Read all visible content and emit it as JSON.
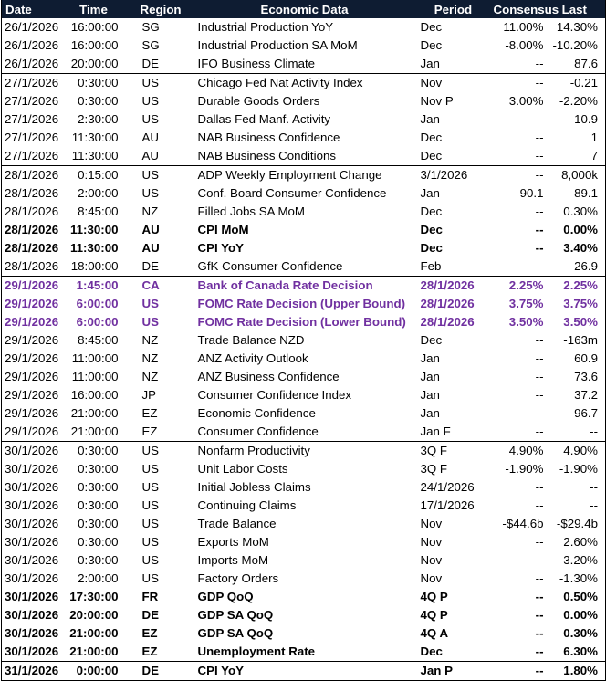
{
  "headers": {
    "date": "Date",
    "time": "Time",
    "region": "Region",
    "event": "Economic Data",
    "period": "Period",
    "consensus": "Consensus",
    "last": "Last"
  },
  "rows": [
    {
      "date": "26/1/2026",
      "time": "16:00:00",
      "region": "SG",
      "event": "Industrial Production YoY",
      "period": "Dec",
      "consensus": "11.00%",
      "last": "14.30%",
      "style": "",
      "group_start": false
    },
    {
      "date": "26/1/2026",
      "time": "16:00:00",
      "region": "SG",
      "event": "Industrial Production SA MoM",
      "period": "Dec",
      "consensus": "-8.00%",
      "last": "-10.20%",
      "style": "",
      "group_start": false
    },
    {
      "date": "26/1/2026",
      "time": "20:00:00",
      "region": "DE",
      "event": "IFO Business Climate",
      "period": "Jan",
      "consensus": "--",
      "last": "87.6",
      "style": "",
      "group_start": false
    },
    {
      "date": "27/1/2026",
      "time": "0:30:00",
      "region": "US",
      "event": "Chicago Fed Nat Activity Index",
      "period": "Nov",
      "consensus": "--",
      "last": "-0.21",
      "style": "",
      "group_start": true
    },
    {
      "date": "27/1/2026",
      "time": "0:30:00",
      "region": "US",
      "event": "Durable Goods Orders",
      "period": "Nov P",
      "consensus": "3.00%",
      "last": "-2.20%",
      "style": "",
      "group_start": false
    },
    {
      "date": "27/1/2026",
      "time": "2:30:00",
      "region": "US",
      "event": "Dallas Fed Manf. Activity",
      "period": "Jan",
      "consensus": "--",
      "last": "-10.9",
      "style": "",
      "group_start": false
    },
    {
      "date": "27/1/2026",
      "time": "11:30:00",
      "region": "AU",
      "event": "NAB Business Confidence",
      "period": "Dec",
      "consensus": "--",
      "last": "1",
      "style": "",
      "group_start": false
    },
    {
      "date": "27/1/2026",
      "time": "11:30:00",
      "region": "AU",
      "event": "NAB Business Conditions",
      "period": "Dec",
      "consensus": "--",
      "last": "7",
      "style": "",
      "group_start": false
    },
    {
      "date": "28/1/2026",
      "time": "0:15:00",
      "region": "US",
      "event": "ADP Weekly Employment Change",
      "period": "3/1/2026",
      "consensus": "--",
      "last": "8,000k",
      "style": "",
      "group_start": true
    },
    {
      "date": "28/1/2026",
      "time": "2:00:00",
      "region": "US",
      "event": "Conf. Board Consumer Confidence",
      "period": "Jan",
      "consensus": "90.1",
      "last": "89.1",
      "style": "",
      "group_start": false
    },
    {
      "date": "28/1/2026",
      "time": "8:45:00",
      "region": "NZ",
      "event": "Filled Jobs SA MoM",
      "period": "Dec",
      "consensus": "--",
      "last": "0.30%",
      "style": "",
      "group_start": false
    },
    {
      "date": "28/1/2026",
      "time": "11:30:00",
      "region": "AU",
      "event": "CPI MoM",
      "period": "Dec",
      "consensus": "--",
      "last": "0.00%",
      "style": "bold",
      "group_start": false
    },
    {
      "date": "28/1/2026",
      "time": "11:30:00",
      "region": "AU",
      "event": "CPI YoY",
      "period": "Dec",
      "consensus": "--",
      "last": "3.40%",
      "style": "bold",
      "group_start": false
    },
    {
      "date": "28/1/2026",
      "time": "18:00:00",
      "region": "DE",
      "event": "GfK Consumer Confidence",
      "period": "Feb",
      "consensus": "--",
      "last": "-26.9",
      "style": "",
      "group_start": false
    },
    {
      "date": "29/1/2026",
      "time": "1:45:00",
      "region": "CA",
      "event": "Bank of Canada Rate Decision",
      "period": "28/1/2026",
      "consensus": "2.25%",
      "last": "2.25%",
      "style": "purple",
      "group_start": true
    },
    {
      "date": "29/1/2026",
      "time": "6:00:00",
      "region": "US",
      "event": "FOMC Rate Decision (Upper Bound)",
      "period": "28/1/2026",
      "consensus": "3.75%",
      "last": "3.75%",
      "style": "purple",
      "group_start": false
    },
    {
      "date": "29/1/2026",
      "time": "6:00:00",
      "region": "US",
      "event": "FOMC Rate Decision (Lower Bound)",
      "period": "28/1/2026",
      "consensus": "3.50%",
      "last": "3.50%",
      "style": "purple",
      "group_start": false
    },
    {
      "date": "29/1/2026",
      "time": "8:45:00",
      "region": "NZ",
      "event": "Trade Balance NZD",
      "period": "Dec",
      "consensus": "--",
      "last": "-163m",
      "style": "",
      "group_start": false
    },
    {
      "date": "29/1/2026",
      "time": "11:00:00",
      "region": "NZ",
      "event": "ANZ Activity Outlook",
      "period": "Jan",
      "consensus": "--",
      "last": "60.9",
      "style": "",
      "group_start": false
    },
    {
      "date": "29/1/2026",
      "time": "11:00:00",
      "region": "NZ",
      "event": "ANZ Business Confidence",
      "period": "Jan",
      "consensus": "--",
      "last": "73.6",
      "style": "",
      "group_start": false
    },
    {
      "date": "29/1/2026",
      "time": "16:00:00",
      "region": "JP",
      "event": "Consumer Confidence Index",
      "period": "Jan",
      "consensus": "--",
      "last": "37.2",
      "style": "",
      "group_start": false
    },
    {
      "date": "29/1/2026",
      "time": "21:00:00",
      "region": "EZ",
      "event": "Economic Confidence",
      "period": "Jan",
      "consensus": "--",
      "last": "96.7",
      "style": "",
      "group_start": false
    },
    {
      "date": "29/1/2026",
      "time": "21:00:00",
      "region": "EZ",
      "event": "Consumer Confidence",
      "period": "Jan F",
      "consensus": "--",
      "last": "--",
      "style": "",
      "group_start": false
    },
    {
      "date": "30/1/2026",
      "time": "0:30:00",
      "region": "US",
      "event": "Nonfarm Productivity",
      "period": "3Q F",
      "consensus": "4.90%",
      "last": "4.90%",
      "style": "",
      "group_start": true
    },
    {
      "date": "30/1/2026",
      "time": "0:30:00",
      "region": "US",
      "event": "Unit Labor Costs",
      "period": "3Q F",
      "consensus": "-1.90%",
      "last": "-1.90%",
      "style": "",
      "group_start": false
    },
    {
      "date": "30/1/2026",
      "time": "0:30:00",
      "region": "US",
      "event": "Initial Jobless Claims",
      "period": "24/1/2026",
      "consensus": "--",
      "last": "--",
      "style": "",
      "group_start": false
    },
    {
      "date": "30/1/2026",
      "time": "0:30:00",
      "region": "US",
      "event": "Continuing Claims",
      "period": "17/1/2026",
      "consensus": "--",
      "last": "--",
      "style": "",
      "group_start": false
    },
    {
      "date": "30/1/2026",
      "time": "0:30:00",
      "region": "US",
      "event": "Trade Balance",
      "period": "Nov",
      "consensus": "-$44.6b",
      "last": "-$29.4b",
      "style": "",
      "group_start": false
    },
    {
      "date": "30/1/2026",
      "time": "0:30:00",
      "region": "US",
      "event": "Exports MoM",
      "period": "Nov",
      "consensus": "--",
      "last": "2.60%",
      "style": "",
      "group_start": false
    },
    {
      "date": "30/1/2026",
      "time": "0:30:00",
      "region": "US",
      "event": "Imports MoM",
      "period": "Nov",
      "consensus": "--",
      "last": "-3.20%",
      "style": "",
      "group_start": false
    },
    {
      "date": "30/1/2026",
      "time": "2:00:00",
      "region": "US",
      "event": "Factory Orders",
      "period": "Nov",
      "consensus": "--",
      "last": "-1.30%",
      "style": "",
      "group_start": false
    },
    {
      "date": "30/1/2026",
      "time": "17:30:00",
      "region": "FR",
      "event": "GDP QoQ",
      "period": "4Q P",
      "consensus": "--",
      "last": "0.50%",
      "style": "bold",
      "group_start": false
    },
    {
      "date": "30/1/2026",
      "time": "20:00:00",
      "region": "DE",
      "event": "GDP SA QoQ",
      "period": "4Q P",
      "consensus": "--",
      "last": "0.00%",
      "style": "bold",
      "group_start": false
    },
    {
      "date": "30/1/2026",
      "time": "21:00:00",
      "region": "EZ",
      "event": "GDP SA QoQ",
      "period": "4Q A",
      "consensus": "--",
      "last": "0.30%",
      "style": "bold",
      "group_start": false
    },
    {
      "date": "30/1/2026",
      "time": "21:00:00",
      "region": "EZ",
      "event": "Unemployment Rate",
      "period": "Dec",
      "consensus": "--",
      "last": "6.30%",
      "style": "bold",
      "group_start": false
    },
    {
      "date": "31/1/2026",
      "time": "0:00:00",
      "region": "DE",
      "event": "CPI YoY",
      "period": "Jan P",
      "consensus": "--",
      "last": "1.80%",
      "style": "bold",
      "group_start": true
    }
  ],
  "colors": {
    "header_bg": "#0e1c32",
    "header_text": "#ffffff",
    "highlight_purple": "#7030a0"
  }
}
